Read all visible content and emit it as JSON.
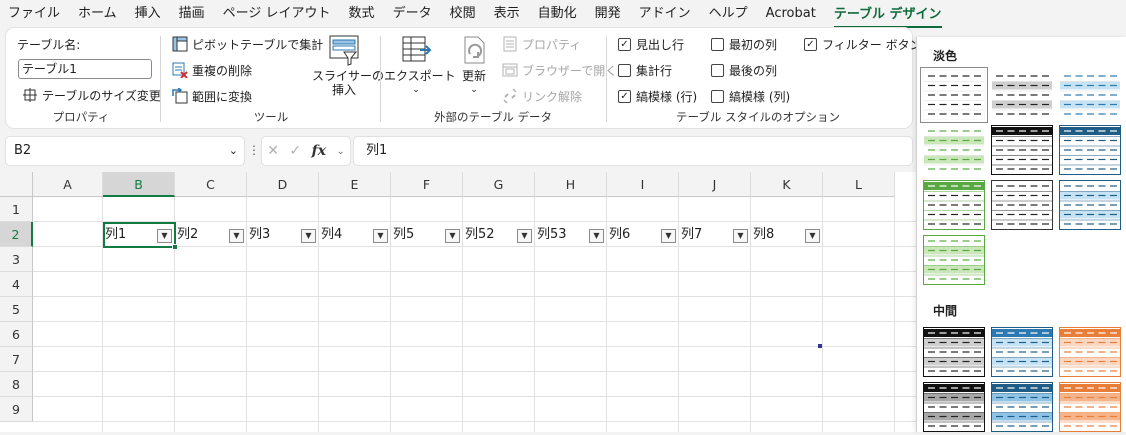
{
  "menu": {
    "tabs": [
      "ファイル",
      "ホーム",
      "挿入",
      "描画",
      "ページ レイアウト",
      "数式",
      "データ",
      "校閲",
      "表示",
      "自動化",
      "開発",
      "アドイン",
      "ヘルプ",
      "Acrobat",
      "テーブル デザイン"
    ],
    "active_tab": "テーブル デザイン"
  },
  "ribbon": {
    "properties": {
      "table_name_label": "テーブル名:",
      "table_name_value": "テーブル1",
      "resize_label": "テーブルのサイズ変更",
      "group_label": "プロパティ"
    },
    "tools": {
      "pivot_label": "ピボットテーブルで集計",
      "remove_dup_label": "重複の削除",
      "convert_label": "範囲に変換",
      "slicer_label_1": "スライサーの",
      "slicer_label_2": "挿入",
      "group_label": "ツール"
    },
    "external": {
      "export_label": "エクスポート",
      "refresh_label": "更新",
      "properties_label": "プロパティ",
      "browser_label": "ブラウザーで開く",
      "unlink_label": "リンク解除",
      "group_label": "外部のテーブル データ"
    },
    "style_options": {
      "header_row": {
        "label": "見出し行",
        "checked": true
      },
      "total_row": {
        "label": "集計行",
        "checked": false
      },
      "banded_rows": {
        "label": "縞模様 (行)",
        "checked": true
      },
      "first_column": {
        "label": "最初の列",
        "checked": false
      },
      "last_column": {
        "label": "最後の列",
        "checked": false
      },
      "banded_columns": {
        "label": "縞模様 (列)",
        "checked": false
      },
      "filter_button": {
        "label": "フィルター ボタン",
        "checked": true
      },
      "group_label": "テーブル スタイルのオプション"
    }
  },
  "formula_bar": {
    "cell_ref": "B2",
    "formula": "列1",
    "fx": "fx"
  },
  "sheet": {
    "columns": [
      "A",
      "B",
      "C",
      "D",
      "E",
      "F",
      "G",
      "H",
      "I",
      "J",
      "K",
      "L"
    ],
    "selected_column": "B",
    "rows": [
      "1",
      "2",
      "3",
      "4",
      "5",
      "6",
      "7",
      "8",
      "9"
    ],
    "selected_row": "2",
    "table_headers": [
      "列1",
      "列2",
      "列3",
      "列4",
      "列5",
      "列52",
      "列53",
      "列6",
      "列7",
      "列8"
    ]
  },
  "gallery": {
    "light_label": "淡色",
    "medium_label": "中間",
    "colors": {
      "light_gray": "#cfcfcf",
      "light_blue": "#c5e3f5",
      "light_green": "#c9e7b8",
      "green_dark": "#5aa843",
      "blue_dark": "#1f5d87",
      "blue_mid": "#2b79b0",
      "orange": "#e87d38",
      "black": "#111111"
    }
  }
}
